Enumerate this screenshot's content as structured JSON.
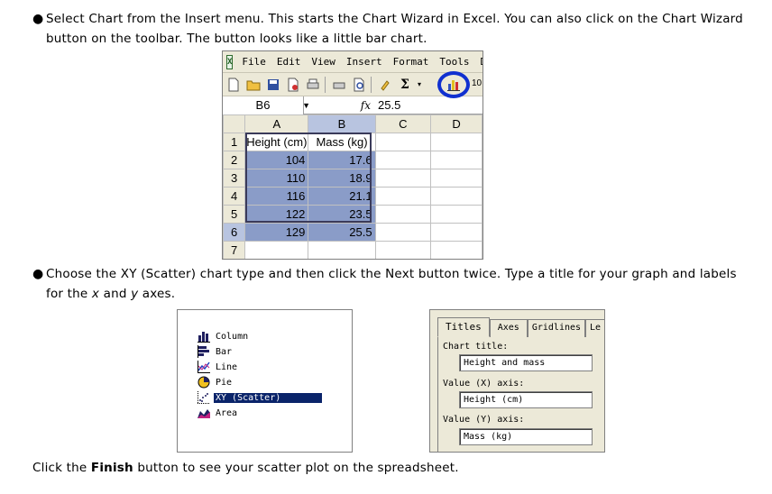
{
  "bullets": {
    "bullet_symbol": "●",
    "b1": "Select Chart from the Insert menu. This starts the Chart Wizard in Excel. You can also click on the Chart Wizard button on the toolbar. The button looks like a little bar chart.",
    "b2_part1": "Choose the XY (Scatter) chart type and then click the Next button twice. Type a title for your graph and labels for the ",
    "b2_x": "x",
    "b2_and": " and ",
    "b2_y": "y",
    "b2_end": " axes."
  },
  "final": {
    "pre": "Click the ",
    "bold": "Finish",
    "post": " button to see your scatter plot on the spreadsheet."
  },
  "excel": {
    "menu": [
      "File",
      "Edit",
      "View",
      "Insert",
      "Format",
      "Tools",
      "Data"
    ],
    "zoom_fragment": "10",
    "namebox": "B6",
    "fx": "fx",
    "formula_value": "25.5",
    "columns": [
      "A",
      "B",
      "C",
      "D"
    ],
    "rows": [
      {
        "n": "1",
        "a": "Height (cm)",
        "b": "Mass (kg)"
      },
      {
        "n": "2",
        "a": "104",
        "b": "17.6"
      },
      {
        "n": "3",
        "a": "110",
        "b": "18.9"
      },
      {
        "n": "4",
        "a": "116",
        "b": "21.1"
      },
      {
        "n": "5",
        "a": "122",
        "b": "23.5"
      },
      {
        "n": "6",
        "a": "129",
        "b": "25.5"
      },
      {
        "n": "7",
        "a": "",
        "b": ""
      }
    ]
  },
  "chart_types": {
    "items": [
      "Column",
      "Bar",
      "Line",
      "Pie",
      "XY (Scatter)",
      "Area"
    ],
    "selected": "XY (Scatter)"
  },
  "titles_dialog": {
    "tabs": [
      "Titles",
      "Axes",
      "Gridlines",
      "Le"
    ],
    "chart_title_label": "Chart title:",
    "chart_title_value": "Height and mass",
    "x_axis_label": "Value (X) axis:",
    "x_axis_value": "Height (cm)",
    "y_axis_label": "Value (Y) axis:",
    "y_axis_value": "Mass (kg)"
  },
  "colors": {
    "highlight": "#8a9cc8",
    "circle": "#1030d0",
    "selected_item": "#0a246a"
  }
}
